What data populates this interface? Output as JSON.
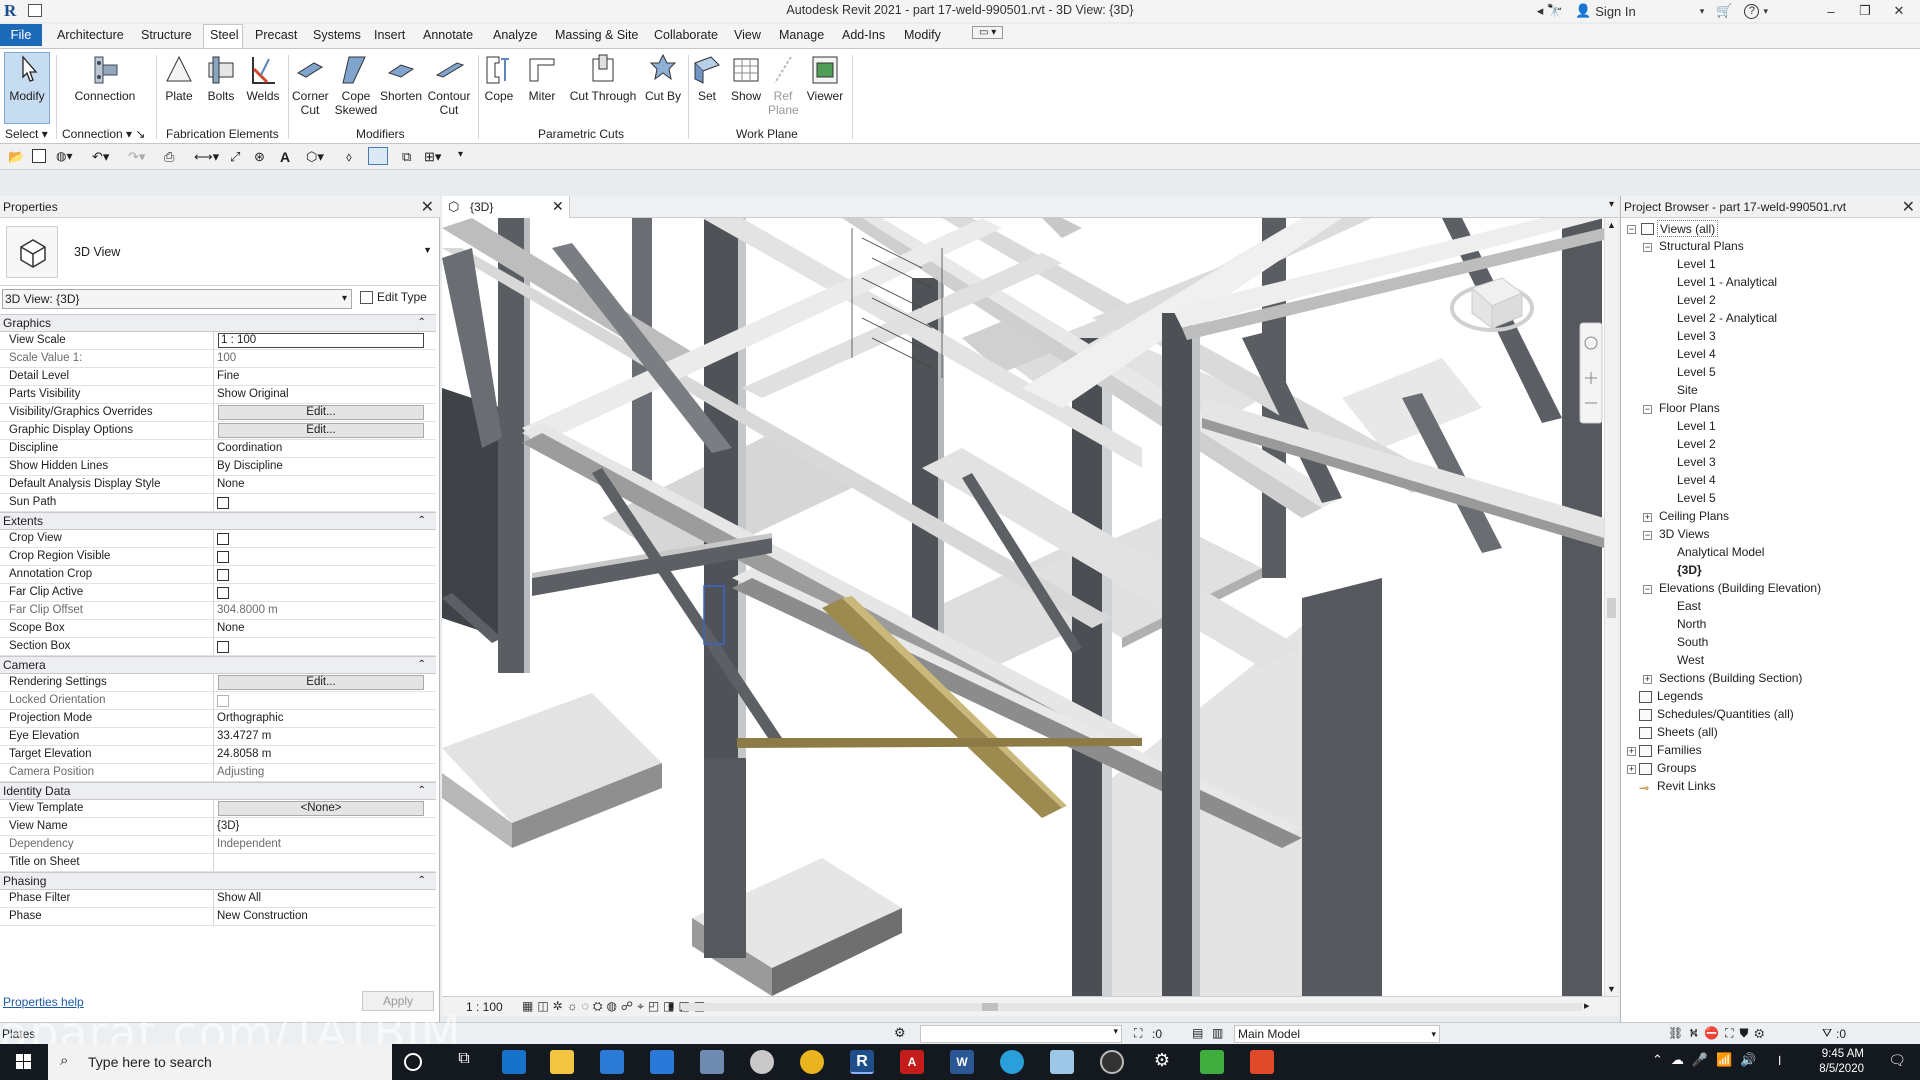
{
  "title_bar": {
    "title": "Autodesk Revit 2021 - part 17-weld-990501.rvt - 3D View: {3D}",
    "sign_in": "Sign In",
    "help": "?"
  },
  "menu": {
    "tabs": [
      "File",
      "Architecture",
      "Structure",
      "Steel",
      "Precast",
      "Systems",
      "Insert",
      "Annotate",
      "Analyze",
      "Massing & Site",
      "Collaborate",
      "View",
      "Manage",
      "Add-Ins",
      "Modify"
    ],
    "active": "Steel"
  },
  "ribbon": {
    "modify": "Modify",
    "connection": "Connection",
    "plate": "Plate",
    "bolts": "Bolts",
    "welds": "Welds",
    "corner_cut": "Corner Cut",
    "cope_skewed": "Cope Skewed",
    "shorten": "Shorten",
    "contour_cut": "Contour Cut",
    "cope": "Cope",
    "miter": "Miter",
    "cut_through": "Cut Through",
    "cut_by": "Cut By",
    "set": "Set",
    "show": "Show",
    "ref_plane": "Ref Plane",
    "viewer": "Viewer",
    "panels": {
      "select": "Select",
      "connection": "Connection",
      "fabrication": "Fabrication Elements",
      "modifiers": "Modifiers",
      "parametric": "Parametric Cuts",
      "work_plane": "Work Plane"
    }
  },
  "properties": {
    "title": "Properties",
    "type_name": "3D View",
    "instance": "3D View: {3D}",
    "edit_type": "Edit Type",
    "groups": {
      "graphics": "Graphics",
      "extents": "Extents",
      "camera": "Camera",
      "identity": "Identity Data",
      "phasing": "Phasing"
    },
    "rows": {
      "view_scale": {
        "label": "View Scale",
        "value": "1 : 100"
      },
      "scale_value": {
        "label": "Scale Value    1:",
        "value": "100"
      },
      "detail_level": {
        "label": "Detail Level",
        "value": "Fine"
      },
      "parts_visibility": {
        "label": "Parts Visibility",
        "value": "Show Original"
      },
      "vg_overrides": {
        "label": "Visibility/Graphics Overrides",
        "value": "Edit..."
      },
      "graphic_display": {
        "label": "Graphic Display Options",
        "value": "Edit..."
      },
      "discipline": {
        "label": "Discipline",
        "value": "Coordination"
      },
      "hidden_lines": {
        "label": "Show Hidden Lines",
        "value": "By Discipline"
      },
      "analysis_style": {
        "label": "Default Analysis Display Style",
        "value": "None"
      },
      "sun_path": {
        "label": "Sun Path"
      },
      "crop_view": {
        "label": "Crop View"
      },
      "crop_region": {
        "label": "Crop Region Visible"
      },
      "annotation_crop": {
        "label": "Annotation Crop"
      },
      "far_clip_active": {
        "label": "Far Clip Active"
      },
      "far_clip_offset": {
        "label": "Far Clip Offset",
        "value": "304.8000 m"
      },
      "scope_box": {
        "label": "Scope Box",
        "value": "None"
      },
      "section_box": {
        "label": "Section Box"
      },
      "rendering": {
        "label": "Rendering Settings",
        "value": "Edit..."
      },
      "locked_orientation": {
        "label": "Locked Orientation"
      },
      "projection": {
        "label": "Projection Mode",
        "value": "Orthographic"
      },
      "eye_elevation": {
        "label": "Eye Elevation",
        "value": "33.4727 m"
      },
      "target_elevation": {
        "label": "Target Elevation",
        "value": "24.8058 m"
      },
      "camera_position": {
        "label": "Camera Position",
        "value": "Adjusting"
      },
      "view_template": {
        "label": "View Template",
        "value": "<None>"
      },
      "view_name": {
        "label": "View Name",
        "value": "{3D}"
      },
      "dependency": {
        "label": "Dependency",
        "value": "Independent"
      },
      "title_on_sheet": {
        "label": "Title on Sheet",
        "value": ""
      },
      "phase_filter": {
        "label": "Phase Filter",
        "value": "Show All"
      },
      "phase": {
        "label": "Phase",
        "value": "New Construction"
      }
    },
    "help_link": "Properties help",
    "apply": "Apply"
  },
  "view": {
    "tab_label": "{3D}",
    "scale": "1 : 100"
  },
  "project_browser": {
    "title": "Project Browser - part 17-weld-990501.rvt",
    "views_all": "Views (all)",
    "structural_plans": "Structural Plans",
    "sp_items": [
      "Level 1",
      "Level 1 - Analytical",
      "Level 2",
      "Level 2 - Analytical",
      "Level 3",
      "Level 4",
      "Level 5",
      "Site"
    ],
    "floor_plans": "Floor Plans",
    "fp_items": [
      "Level 1",
      "Level 2",
      "Level 3",
      "Level 4",
      "Level 5"
    ],
    "ceiling_plans": "Ceiling Plans",
    "views_3d": "3D Views",
    "v3d_items": [
      "Analytical Model",
      "{3D}"
    ],
    "elevations": "Elevations (Building Elevation)",
    "el_items": [
      "East",
      "North",
      "South",
      "West"
    ],
    "sections": "Sections (Building Section)",
    "legends": "Legends",
    "schedules": "Schedules/Quantities (all)",
    "sheets": "Sheets (all)",
    "families": "Families",
    "groups": "Groups",
    "revit_links": "Revit Links"
  },
  "status_bar": {
    "text": "Plates",
    "zero1": ":0",
    "model": "Main Model",
    "zero2": ":0"
  },
  "watermark": "aparat.com/TATBIM",
  "taskbar": {
    "search_placeholder": "Type here to search",
    "time": "9:45 AM",
    "date": "8/5/2020"
  },
  "colors": {
    "file_tab": "#1c69b8",
    "taskbar": "#14181f",
    "steel_dark": "#4f5358",
    "steel_light": "#e2e2e2",
    "brace": "#9d8a4e"
  }
}
